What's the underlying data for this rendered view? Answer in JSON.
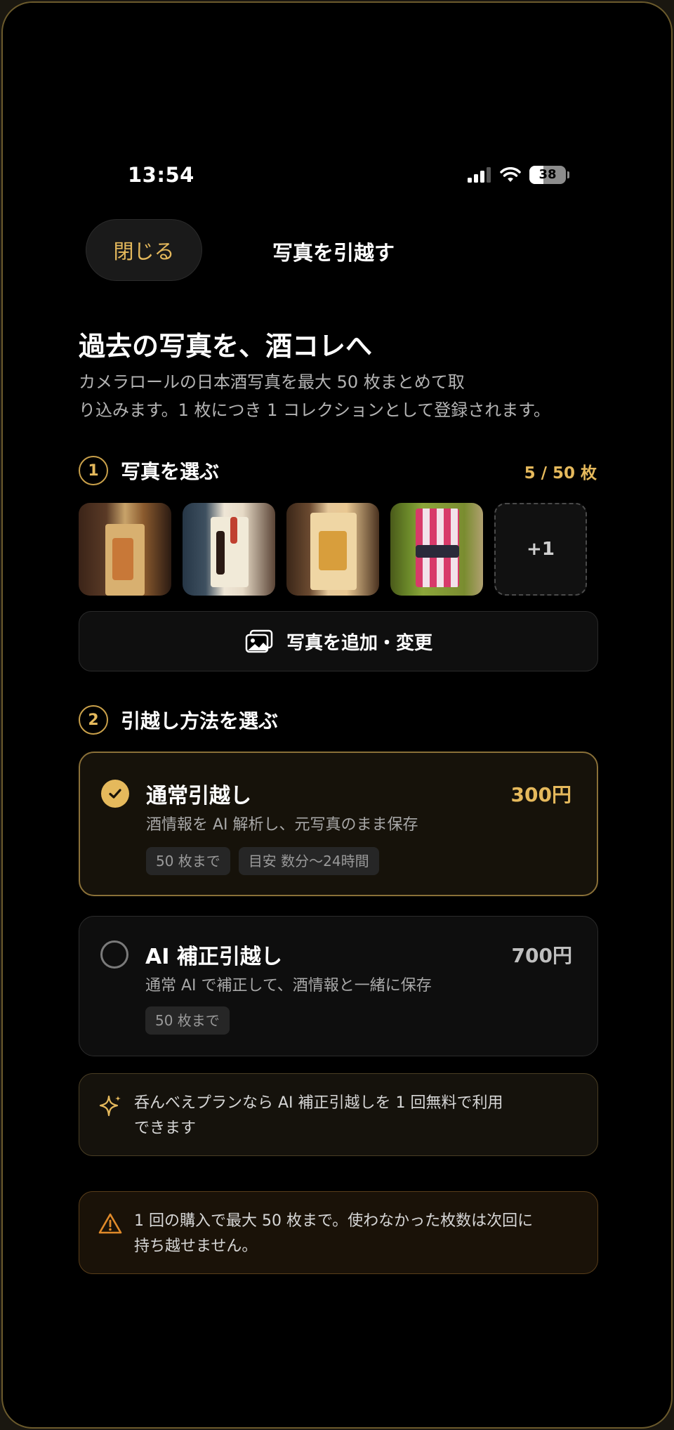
{
  "status": {
    "time": "13:54",
    "battery": "38"
  },
  "nav": {
    "close_label": "閉じる",
    "title": "写真を引越す"
  },
  "hero": {
    "title": "過去の写真を、酒コレへ",
    "desc_line1": "カメラロールの日本酒写真を最大 50 枚まとめて取",
    "desc_line2": "り込みます。1 枚につき 1 コレクションとして登録されます。"
  },
  "step1": {
    "num": "1",
    "label": "写真を選ぶ",
    "count": "5 / 50 枚"
  },
  "photos": {
    "more_label": "+1",
    "add_label": "写真を追加・変更"
  },
  "step2": {
    "num": "2",
    "label": "引越し方法を選ぶ"
  },
  "options": [
    {
      "title": "通常引越し",
      "price": "300円",
      "desc": "酒情報を AI 解析し、元写真のまま保存",
      "tags": [
        "50 枚まで",
        "目安 数分〜24時間"
      ],
      "selected": true
    },
    {
      "title": "AI 補正引越し",
      "price": "700円",
      "desc": "通常 AI で補正して、酒情報と一緒に保存",
      "tags": [
        "50 枚まで"
      ],
      "selected": false
    }
  ],
  "notes": {
    "plan_line1": "呑んべえプランなら AI 補正引越しを 1 回無料で利用",
    "plan_line2": "できます",
    "warn_line1": "1 回の購入で最大 50 枚まで。使わなかった枚数は次回に",
    "warn_line2": "持ち越せません。"
  },
  "colors": {
    "accent": "#e5b95c",
    "warning": "#e08a2a"
  },
  "icons": [
    "signal-icon",
    "wifi-icon",
    "battery-icon",
    "photos-icon",
    "check-icon",
    "sparkle-icon",
    "warning-icon"
  ]
}
